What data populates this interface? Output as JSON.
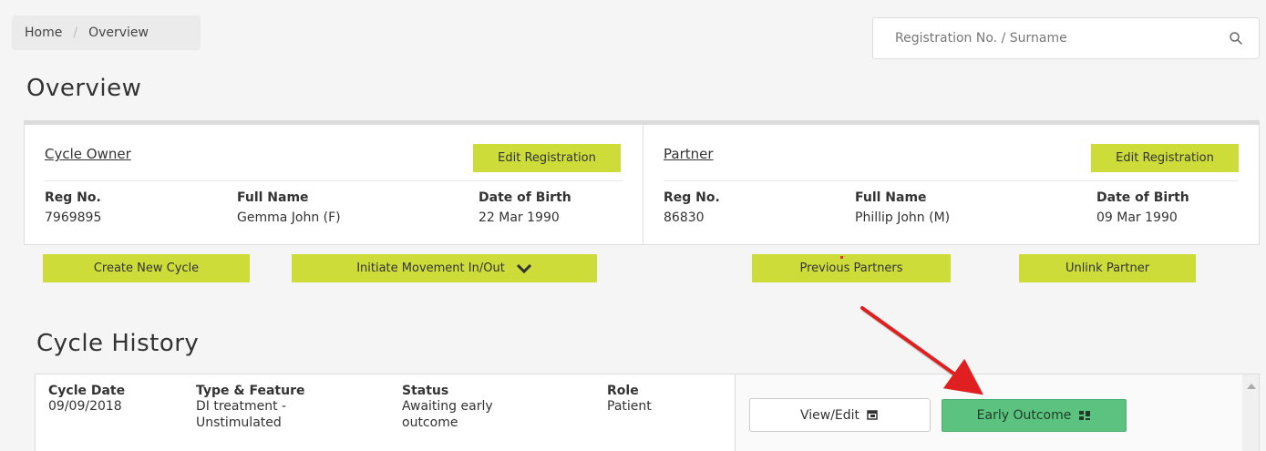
{
  "breadcrumb": {
    "home": "Home",
    "separator": "/",
    "current": "Overview"
  },
  "search": {
    "placeholder": "Registration No. / Surname",
    "icon": "search-icon"
  },
  "page_title": "Overview",
  "cycle_owner": {
    "heading": "Cycle Owner",
    "edit_label": "Edit Registration",
    "labels": {
      "reg": "Reg No.",
      "name": "Full Name",
      "dob": "Date of Birth"
    },
    "reg_no": "7969895",
    "full_name": "Gemma John (F)",
    "dob": "22 Mar 1990"
  },
  "partner": {
    "heading": "Partner",
    "edit_label": "Edit Registration",
    "labels": {
      "reg": "Reg No.",
      "name": "Full Name",
      "dob": "Date of Birth"
    },
    "reg_no": "86830",
    "full_name": "Phillip John (M)",
    "dob": "09 Mar 1990"
  },
  "actions": {
    "create_cycle": "Create New Cycle",
    "initiate_movement": "Initiate Movement In/Out",
    "previous_partners": "Previous Partners",
    "unlink_partner": "Unlink Partner"
  },
  "cycle_history": {
    "title": "Cycle History",
    "headers": {
      "date": "Cycle Date",
      "type": "Type & Feature",
      "status": "Status",
      "role": "Role"
    },
    "row": {
      "date": "09/09/2018",
      "type_line1": "DI treatment -",
      "type_line2": "Unstimulated",
      "status_line1": "Awaiting early",
      "status_line2": "outcome",
      "role": "Patient"
    },
    "view_edit_label": "View/Edit",
    "early_outcome_label": "Early Outcome"
  },
  "colors": {
    "lime": "#cddc39",
    "green": "#5cc27f",
    "annotation_red": "#e02020"
  }
}
